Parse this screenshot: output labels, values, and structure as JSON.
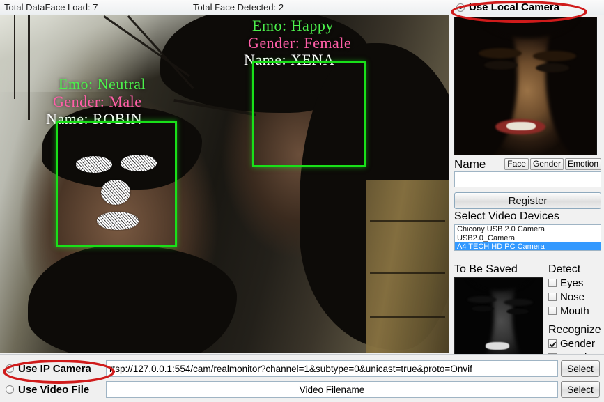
{
  "topbar": {
    "total_dataface_load": "Total DataFace Load: 7",
    "total_face_detected": "Total Face Detected: 2",
    "use_local_camera": "Use Local Camera"
  },
  "video": {
    "faces": [
      {
        "emotion": "Emo: Neutral",
        "gender": "Gender: Male",
        "name": "Name: ROBIN"
      },
      {
        "emotion": "Emo: Happy",
        "gender": "Gender: Female",
        "name": "Name: XENA"
      }
    ]
  },
  "side_panel": {
    "name_label": "Name",
    "mini_buttons": [
      {
        "label": "Face"
      },
      {
        "label": "Gender"
      },
      {
        "label": "Emotion"
      }
    ],
    "name_value": "",
    "name_placeholder": "",
    "register_label": "Register",
    "devices_title": "Select Video Devices",
    "devices": [
      {
        "label": "Chicony USB 2.0 Camera",
        "selected": false
      },
      {
        "label": "USB2.0_Camera",
        "selected": false
      },
      {
        "label": "A4 TECH HD PC Camera",
        "selected": true
      }
    ],
    "to_be_saved_title": "To Be Saved",
    "detect_title": "Detect",
    "detect_options": [
      {
        "label": "Eyes",
        "checked": false
      },
      {
        "label": "Nose",
        "checked": false
      },
      {
        "label": "Mouth",
        "checked": false
      }
    ],
    "recognize_title": "Recognize",
    "recognize_options": [
      {
        "label": "Gender",
        "checked": true
      },
      {
        "label": "Emotion",
        "checked": true
      }
    ]
  },
  "bottom": {
    "use_ip_camera": "Use IP Camera",
    "ip_url": "rtsp://127.0.0.1:554/cam/realmonitor?channel=1&subtype=0&unicast=true&proto=Onvif",
    "ip_select_label": "Select",
    "use_video_file": "Use Video File",
    "video_filename": "Video Filename",
    "file_select_label": "Select"
  },
  "colors": {
    "annotation_red": "#d01b1b",
    "face_box_green": "#19e019",
    "label_emotion": "#4cf04c",
    "label_gender": "#ff5fa8",
    "label_name": "#ffffff",
    "selection_blue": "#3399ff"
  }
}
